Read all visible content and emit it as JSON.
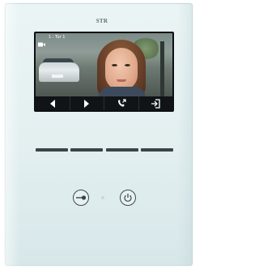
{
  "device": {
    "brand": "STR",
    "colors": {
      "panel": "#e3eff0",
      "screen_controls": "#101416",
      "divider": "#3b4446"
    }
  },
  "screen": {
    "camera_icon": "camera-icon",
    "camera_label": "1 : Tür 1",
    "video_content": "visitor-face-video",
    "controls": [
      {
        "name": "prev-camera-button",
        "icon": "left-triangle-icon"
      },
      {
        "name": "next-camera-button",
        "icon": "right-triangle-icon"
      },
      {
        "name": "call-button",
        "icon": "phone-call-icon"
      },
      {
        "name": "exit-button",
        "icon": "exit-door-icon"
      }
    ]
  },
  "hardware_buttons": [
    {
      "name": "door-open-button",
      "icon": "key-icon"
    },
    {
      "name": "power-button",
      "icon": "power-icon"
    }
  ]
}
